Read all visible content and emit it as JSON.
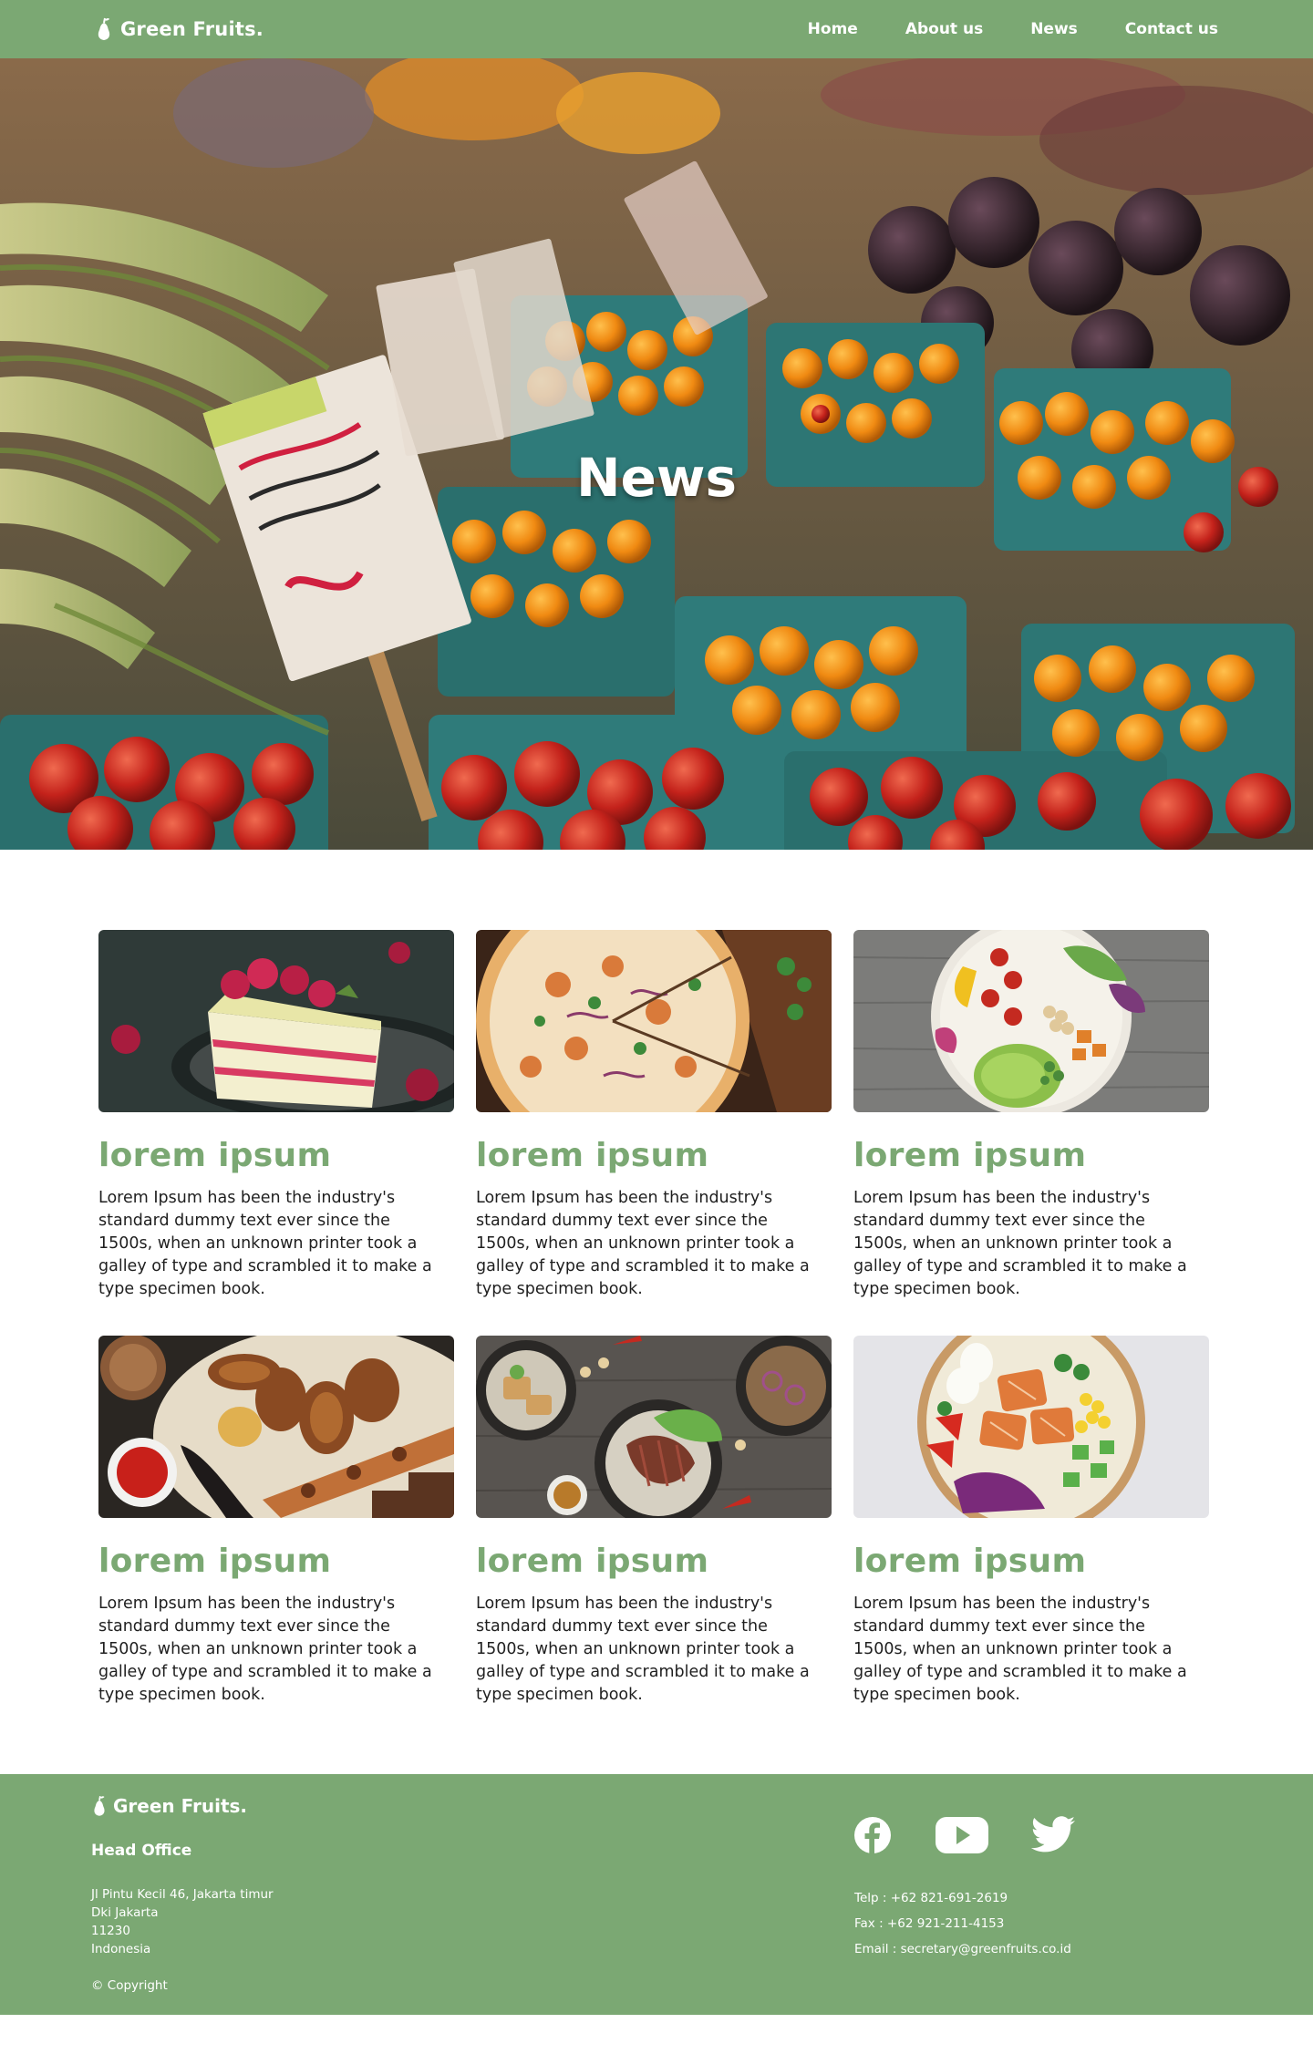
{
  "nav": {
    "brand": "Green Fruits.",
    "logo_icon": "pear-icon",
    "links": [
      "Home",
      "About us",
      "News",
      "Contact us"
    ]
  },
  "hero": {
    "title": "News",
    "background": "fresh-produce-market-photo"
  },
  "news": {
    "cards": [
      {
        "image": "raspberry-cake-photo",
        "title": "lorem ipsum",
        "text": "Lorem Ipsum has been the industry's standard dummy text ever since the 1500s, when an unknown printer took a galley of type and scrambled it to make a type specimen book."
      },
      {
        "image": "pizza-photo",
        "title": "lorem ipsum",
        "text": "Lorem Ipsum has been the industry's standard dummy text ever since the 1500s, when an unknown printer took a galley of type and scrambled it to make a type specimen book."
      },
      {
        "image": "salad-bowl-photo",
        "title": "lorem ipsum",
        "text": "Lorem Ipsum has been the industry's standard dummy text ever since the 1500s, when an unknown printer took a galley of type and scrambled it to make a type specimen book."
      },
      {
        "image": "grilled-meat-platter-photo",
        "title": "lorem ipsum",
        "text": "Lorem Ipsum has been the industry's standard dummy text ever since the 1500s, when an unknown printer took a galley of type and scrambled it to make a type specimen book."
      },
      {
        "image": "steak-dishes-photo",
        "title": "lorem ipsum",
        "text": "Lorem Ipsum has been the industry's standard dummy text ever since the 1500s, when an unknown printer took a galley of type and scrambled it to make a type specimen book."
      },
      {
        "image": "salmon-salad-bowl-photo",
        "title": "lorem ipsum",
        "text": "Lorem Ipsum has been the industry's standard dummy text ever since the 1500s, when an unknown printer took a galley of type and scrambled it to make a type specimen book."
      }
    ]
  },
  "footer": {
    "brand": "Green Fruits.",
    "office_heading": "Head Office",
    "address": [
      "Jl Pintu Kecil 46, Jakarta timur",
      "Dki Jakarta",
      "11230",
      "Indonesia"
    ],
    "copyright": "© Copyright",
    "social_icons": [
      "facebook-icon",
      "youtube-icon",
      "twitter-icon"
    ],
    "contact": {
      "telp": "Telp : +62 821-691-2619",
      "fax": "Fax : +62 921-211-4153",
      "email": "Email : secretary@greenfruits.co.id"
    }
  },
  "colors": {
    "brand_green": "#7ba873",
    "text_dark": "#1f1f1f",
    "white": "#ffffff"
  }
}
